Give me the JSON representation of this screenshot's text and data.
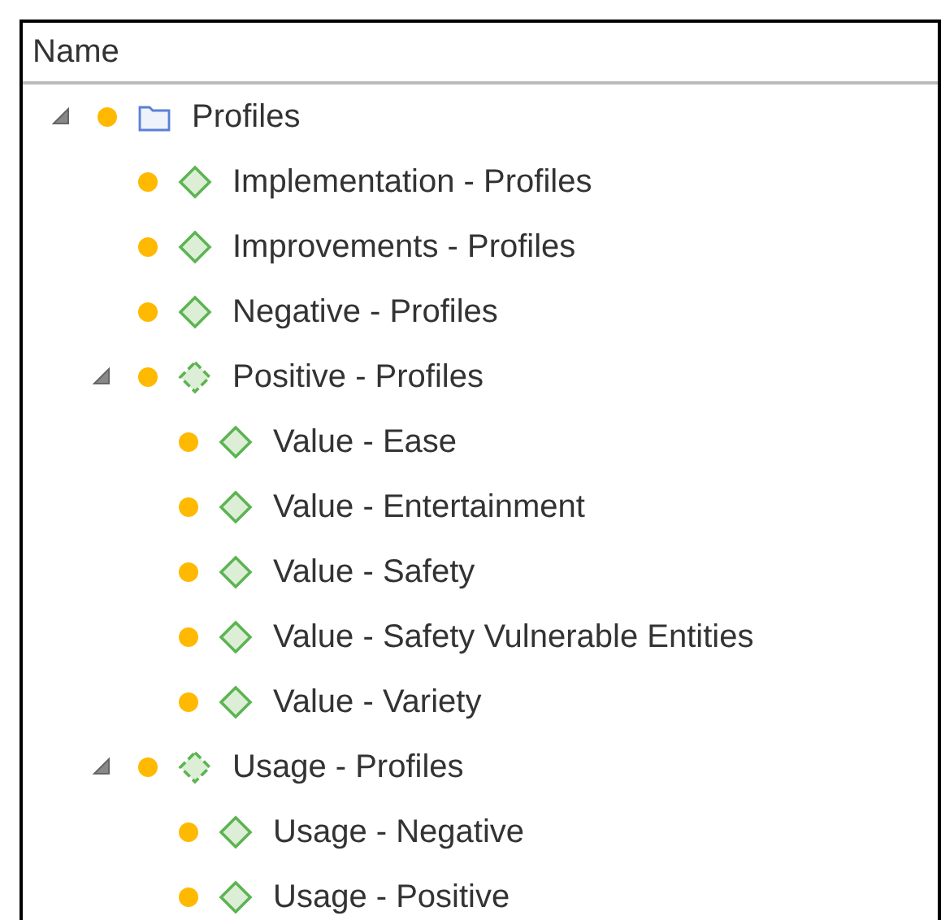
{
  "header": {
    "column_1": "Name"
  },
  "tree": [
    {
      "label": "Profiles",
      "kind": "folder",
      "expanded": true,
      "children": [
        {
          "label": "Implementation - Profiles",
          "kind": "code"
        },
        {
          "label": "Improvements - Profiles",
          "kind": "code"
        },
        {
          "label": "Negative - Profiles",
          "kind": "code"
        },
        {
          "label": "Positive - Profiles",
          "kind": "code-group",
          "expanded": true,
          "children": [
            {
              "label": "Value - Ease",
              "kind": "code"
            },
            {
              "label": "Value - Entertainment",
              "kind": "code"
            },
            {
              "label": "Value - Safety",
              "kind": "code"
            },
            {
              "label": "Value - Safety Vulnerable Entities",
              "kind": "code"
            },
            {
              "label": "Value - Variety",
              "kind": "code"
            }
          ]
        },
        {
          "label": "Usage - Profiles",
          "kind": "code-group",
          "expanded": true,
          "children": [
            {
              "label": "Usage - Negative",
              "kind": "code"
            },
            {
              "label": "Usage - Positive",
              "kind": "code"
            }
          ]
        }
      ]
    }
  ]
}
